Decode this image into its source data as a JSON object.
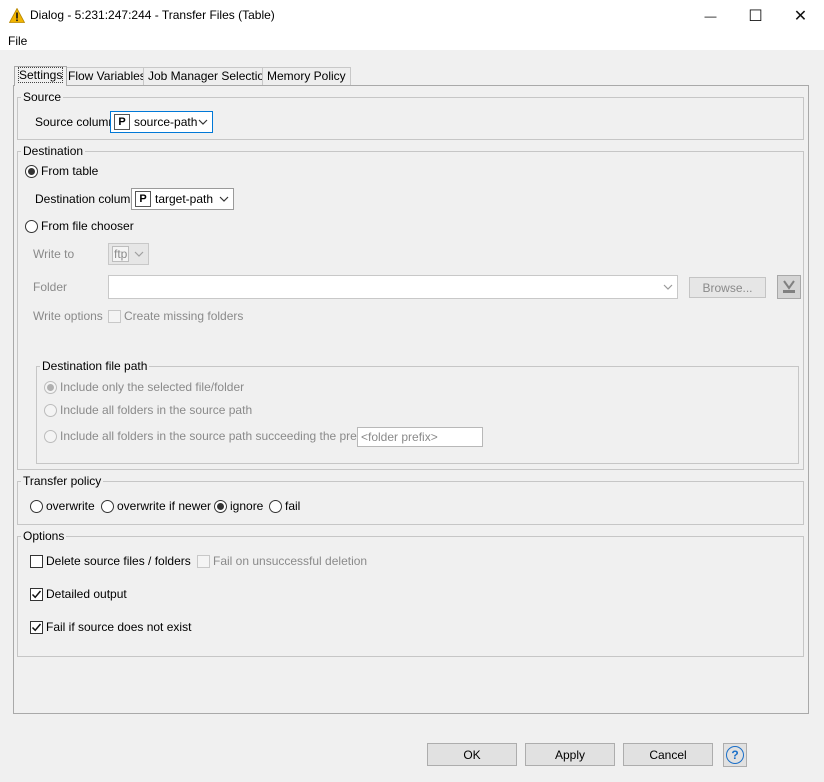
{
  "window": {
    "title": "Dialog - 5:231:247:244 - Transfer Files (Table)",
    "controls": {
      "minimize": "—",
      "maximize": "☐",
      "close": "✕"
    }
  },
  "menu": {
    "file": "File"
  },
  "tabs": [
    "Settings",
    "Flow Variables",
    "Job Manager Selection",
    "Memory Policy"
  ],
  "source": {
    "legend": "Source",
    "column_label": "Source column",
    "column_type": "P",
    "column_value": "source-path"
  },
  "destination": {
    "legend": "Destination",
    "from_table_label": "From table",
    "column_label": "Destination column",
    "column_type": "P",
    "column_value": "target-path",
    "from_file_chooser_label": "From file chooser",
    "write_to_label": "Write to",
    "write_to_value": "ftp",
    "folder_label": "Folder",
    "folder_value": "",
    "browse_label": "Browse...",
    "write_options_label": "Write options",
    "create_missing_label": "Create missing folders",
    "file_path": {
      "legend": "Destination file path",
      "opt_selected": "Include only the selected file/folder",
      "opt_all": "Include all folders in the source path",
      "opt_prefix": "Include all folders in the source path succeeding the prefix",
      "prefix_value": "<folder prefix>"
    }
  },
  "transfer_policy": {
    "legend": "Transfer policy",
    "options": [
      "overwrite",
      "overwrite if newer",
      "ignore",
      "fail"
    ],
    "selected": "ignore"
  },
  "options": {
    "legend": "Options",
    "delete_source": "Delete source files / folders",
    "fail_unsuccessful": "Fail on unsuccessful deletion",
    "detailed_output": "Detailed output",
    "fail_not_exist": "Fail if source does not exist"
  },
  "buttons": {
    "ok": "OK",
    "apply": "Apply",
    "cancel": "Cancel",
    "help": "?"
  },
  "colors": {
    "title_icon": "#f2b400",
    "focus": "#0078d7",
    "help": "#1a6fc8"
  }
}
